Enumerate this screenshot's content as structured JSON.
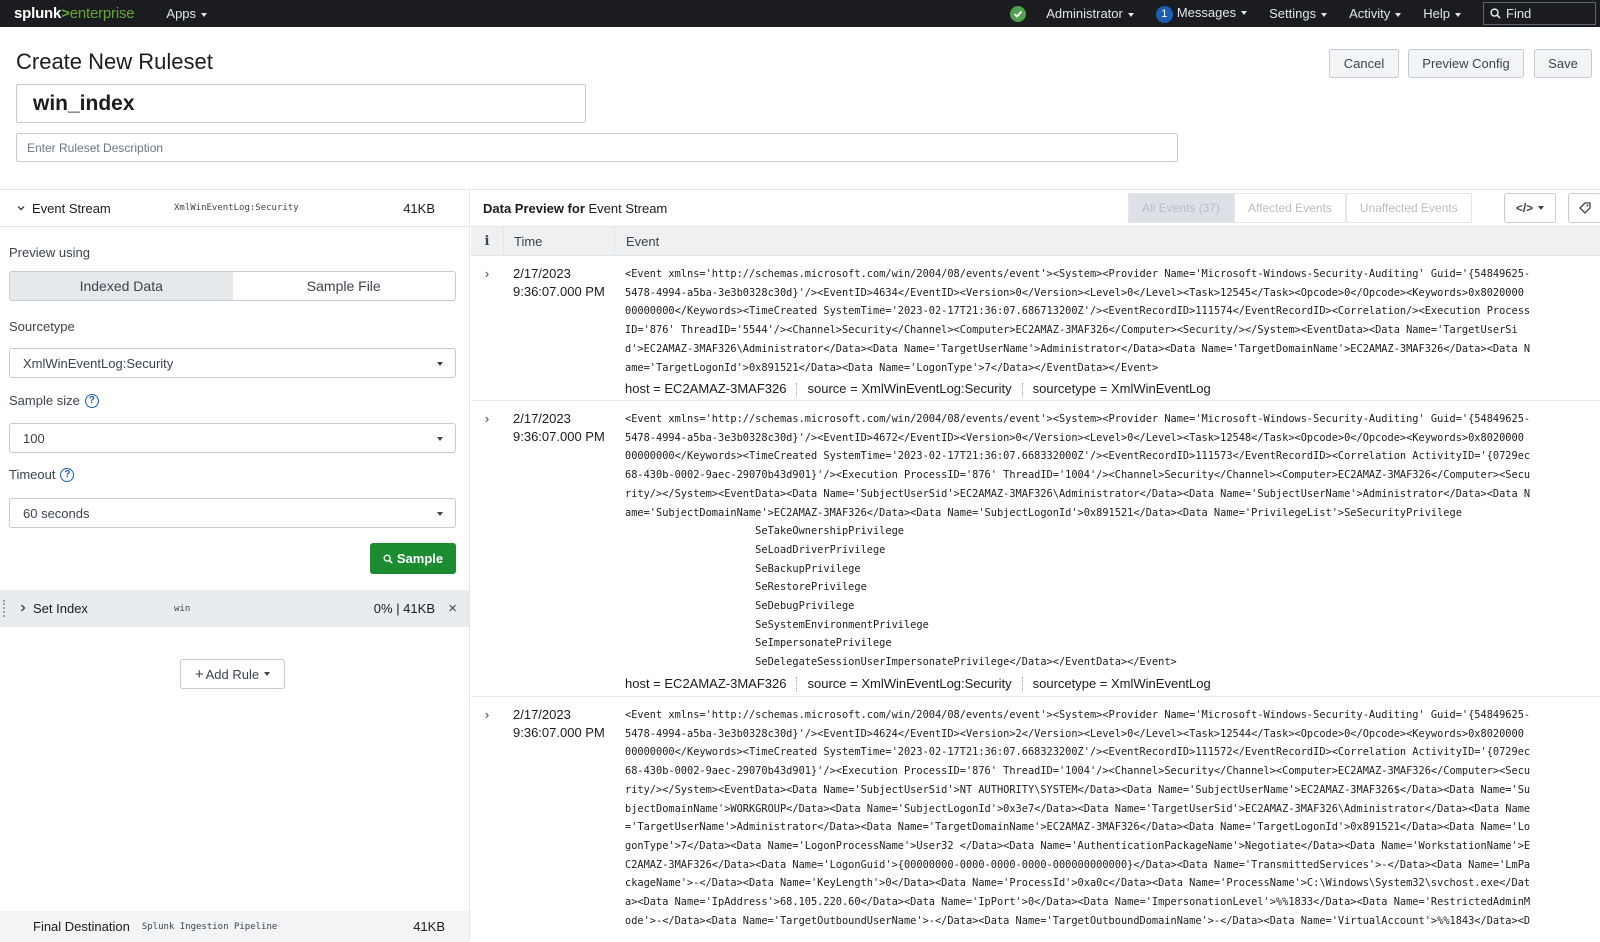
{
  "topbar": {
    "logo_primary": "splunk",
    "logo_gt": ">",
    "logo_secondary": "enterprise",
    "apps": "Apps",
    "status_icon": "check-circle-icon",
    "administrator": "Administrator",
    "messages_count": "1",
    "messages": "Messages",
    "settings": "Settings",
    "activity": "Activity",
    "help": "Help",
    "find_placeholder": "Find"
  },
  "header": {
    "title": "Create New Ruleset",
    "ruleset_name": "win_index",
    "description_placeholder": "Enter Ruleset Description",
    "cancel": "Cancel",
    "preview_config": "Preview Config",
    "save": "Save"
  },
  "left": {
    "event_stream": {
      "label": "Event Stream",
      "sourcetype": "XmlWinEventLog:Security",
      "size": "41KB"
    },
    "preview_using_label": "Preview using",
    "preview_options": [
      "Indexed Data",
      "Sample File"
    ],
    "sourcetype_label": "Sourcetype",
    "sourcetype_value": "XmlWinEventLog:Security",
    "sample_size_label": "Sample size",
    "sample_size_value": "100",
    "timeout_label": "Timeout",
    "timeout_value": "60 seconds",
    "sample_button": "Sample",
    "set_index": {
      "label": "Set Index",
      "value": "win",
      "stats": "0% | 41KB",
      "close": "×"
    },
    "add_rule": "Add Rule",
    "final_destination": {
      "label": "Final Destination",
      "value": "Splunk Ingestion Pipeline",
      "size": "41KB"
    }
  },
  "preview": {
    "title_bold": "Data Preview for",
    "title_rest": "Event Stream",
    "filters": [
      "All Events (37)",
      "Affected Events",
      "Unaffected Events"
    ],
    "code_button": "</>",
    "columns": {
      "info": "i",
      "time": "Time",
      "event": "Event"
    },
    "events": [
      {
        "date": "2/17/2023",
        "time": "9:36:07.000 PM",
        "lines": [
          "<Event xmlns='http://schemas.microsoft.com/win/2004/08/events/event'><System><Provider Name='Microsoft-Windows-Security-Auditing' Guid='{54849625-",
          "5478-4994-a5ba-3e3b0328c30d}'/><EventID>4634</EventID><Version>0</Version><Level>0</Level><Task>12545</Task><Opcode>0</Opcode><Keywords>0x8020000",
          "00000000</Keywords><TimeCreated SystemTime='2023-02-17T21:36:07.686713200Z'/><EventRecordID>111574</EventRecordID><Correlation/><Execution Process",
          "ID='876' ThreadID='5544'/><Channel>Security</Channel><Computer>EC2AMAZ-3MAF326</Computer><Security/></System><EventData><Data Name='TargetUserSi",
          "d'>EC2AMAZ-3MAF326\\Administrator</Data><Data Name='TargetUserName'>Administrator</Data><Data Name='TargetDomainName'>EC2AMAZ-3MAF326</Data><Data N",
          "ame='TargetLogonId'>0x891521</Data><Data Name='LogonType'>7</Data></EventData></Event>"
        ],
        "host": "host = EC2AMAZ-3MAF326",
        "source": "source = XmlWinEventLog:Security",
        "sourcetype": "sourcetype = XmlWinEventLog"
      },
      {
        "date": "2/17/2023",
        "time": "9:36:07.000 PM",
        "lines": [
          "<Event xmlns='http://schemas.microsoft.com/win/2004/08/events/event'><System><Provider Name='Microsoft-Windows-Security-Auditing' Guid='{54849625-",
          "5478-4994-a5ba-3e3b0328c30d}'/><EventID>4672</EventID><Version>0</Version><Level>0</Level><Task>12548</Task><Opcode>0</Opcode><Keywords>0x8020000",
          "00000000</Keywords><TimeCreated SystemTime='2023-02-17T21:36:07.668332000Z'/><EventRecordID>111573</EventRecordID><Correlation ActivityID='{0729ec",
          "68-430b-0002-9aec-29070b43d901}'/><Execution ProcessID='876' ThreadID='1004'/><Channel>Security</Channel><Computer>EC2AMAZ-3MAF326</Computer><Secu",
          "rity/></System><EventData><Data Name='SubjectUserSid'>EC2AMAZ-3MAF326\\Administrator</Data><Data Name='SubjectUserName'>Administrator</Data><Data N",
          "ame='SubjectDomainName'>EC2AMAZ-3MAF326</Data><Data Name='SubjectLogonId'>0x891521</Data><Data Name='PrivilegeList'>SeSecurityPrivilege",
          "                     SeTakeOwnershipPrivilege",
          "                     SeLoadDriverPrivilege",
          "                     SeBackupPrivilege",
          "                     SeRestorePrivilege",
          "                     SeDebugPrivilege",
          "                     SeSystemEnvironmentPrivilege",
          "                     SeImpersonatePrivilege",
          "                     SeDelegateSessionUserImpersonatePrivilege</Data></EventData></Event>"
        ],
        "host": "host = EC2AMAZ-3MAF326",
        "source": "source = XmlWinEventLog:Security",
        "sourcetype": "sourcetype = XmlWinEventLog"
      },
      {
        "date": "2/17/2023",
        "time": "9:36:07.000 PM",
        "lines": [
          "<Event xmlns='http://schemas.microsoft.com/win/2004/08/events/event'><System><Provider Name='Microsoft-Windows-Security-Auditing' Guid='{54849625-",
          "5478-4994-a5ba-3e3b0328c30d}'/><EventID>4624</EventID><Version>2</Version><Level>0</Level><Task>12544</Task><Opcode>0</Opcode><Keywords>0x8020000",
          "00000000</Keywords><TimeCreated SystemTime='2023-02-17T21:36:07.668323200Z'/><EventRecordID>111572</EventRecordID><Correlation ActivityID='{0729ec",
          "68-430b-0002-9aec-29070b43d901}'/><Execution ProcessID='876' ThreadID='1004'/><Channel>Security</Channel><Computer>EC2AMAZ-3MAF326</Computer><Secu",
          "rity/></System><EventData><Data Name='SubjectUserSid'>NT AUTHORITY\\SYSTEM</Data><Data Name='SubjectUserName'>EC2AMAZ-3MAF326$</Data><Data Name='Su",
          "bjectDomainName'>WORKGROUP</Data><Data Name='SubjectLogonId'>0x3e7</Data><Data Name='TargetUserSid'>EC2AMAZ-3MAF326\\Administrator</Data><Data Name",
          "='TargetUserName'>Administrator</Data><Data Name='TargetDomainName'>EC2AMAZ-3MAF326</Data><Data Name='TargetLogonId'>0x891521</Data><Data Name='Lo",
          "gonType'>7</Data><Data Name='LogonProcessName'>User32 </Data><Data Name='AuthenticationPackageName'>Negotiate</Data><Data Name='WorkstationName'>E",
          "C2AMAZ-3MAF326</Data><Data Name='LogonGuid'>{00000000-0000-0000-0000-000000000000}</Data><Data Name='TransmittedServices'>-</Data><Data Name='LmPa",
          "ckageName'>-</Data><Data Name='KeyLength'>0</Data><Data Name='ProcessId'>0xa0c</Data><Data Name='ProcessName'>C:\\Windows\\System32\\svchost.exe</Dat",
          "a><Data Name='IpAddress'>68.105.220.60</Data><Data Name='IpPort'>0</Data><Data Name='ImpersonationLevel'>%%1833</Data><Data Name='RestrictedAdminM",
          "ode'>-</Data><Data Name='TargetOutboundUserName'>-</Data><Data Name='TargetOutboundDomainName'>-</Data><Data Name='VirtualAccount'>%%1843</Data><D"
        ]
      }
    ]
  }
}
